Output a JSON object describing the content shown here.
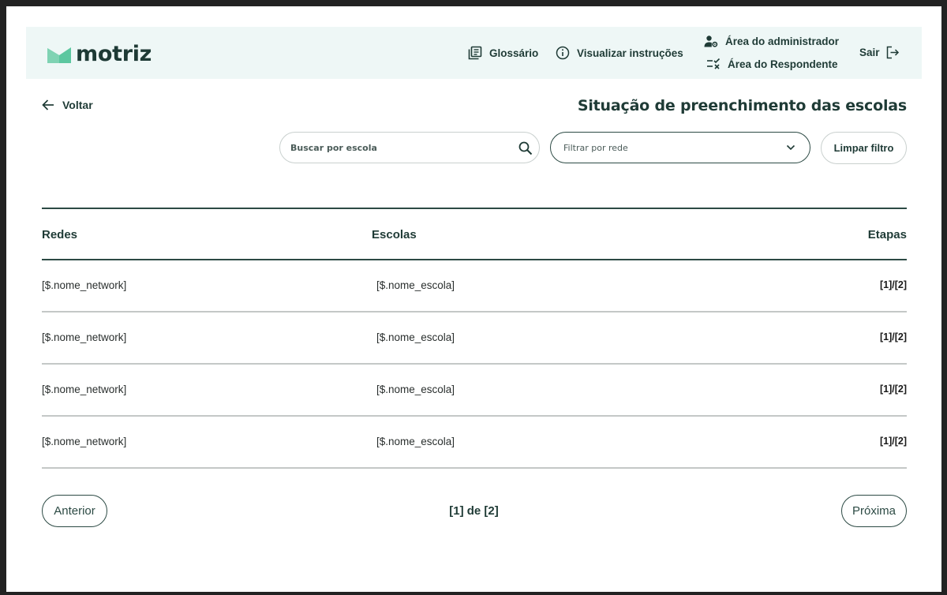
{
  "brand": {
    "name": "motriz",
    "color": "#5cc7a0"
  },
  "nav": {
    "glossario": "Glossário",
    "instrucoes": "Visualizar instruções",
    "admin": "Área do administrador",
    "respondente": "Área do Respondente",
    "sair": "Sair"
  },
  "page": {
    "back_label": "Voltar",
    "title": "Situação de preenchimento das escolas"
  },
  "filters": {
    "search_placeholder": "Buscar por escola",
    "network_placeholder": "Filtrar por rede",
    "clear_label": "Limpar filtro"
  },
  "table": {
    "columns": [
      "Redes",
      "Escolas",
      "Etapas"
    ],
    "rows": [
      {
        "rede": "[$.nome_network]",
        "escola": "[$.nome_escola]",
        "etapas": "[1]/[2]"
      },
      {
        "rede": "[$.nome_network]",
        "escola": "[$.nome_escola]",
        "etapas": "[1]/[2]"
      },
      {
        "rede": "[$.nome_network]",
        "escola": "[$.nome_escola]",
        "etapas": "[1]/[2]"
      },
      {
        "rede": "[$.nome_network]",
        "escola": "[$.nome_escola]",
        "etapas": "[1]/[2]"
      }
    ]
  },
  "pagination": {
    "prev_label": "Anterior",
    "next_label": "Próxima",
    "info": "[1] de [2]"
  },
  "icons": {
    "glossario": "book-icon",
    "instrucoes": "info-icon",
    "admin": "user-gear-icon",
    "respondente": "checklist-icon",
    "sair": "logout-icon",
    "back": "arrow-left-icon",
    "search": "search-icon",
    "select": "chevron-down-icon"
  }
}
